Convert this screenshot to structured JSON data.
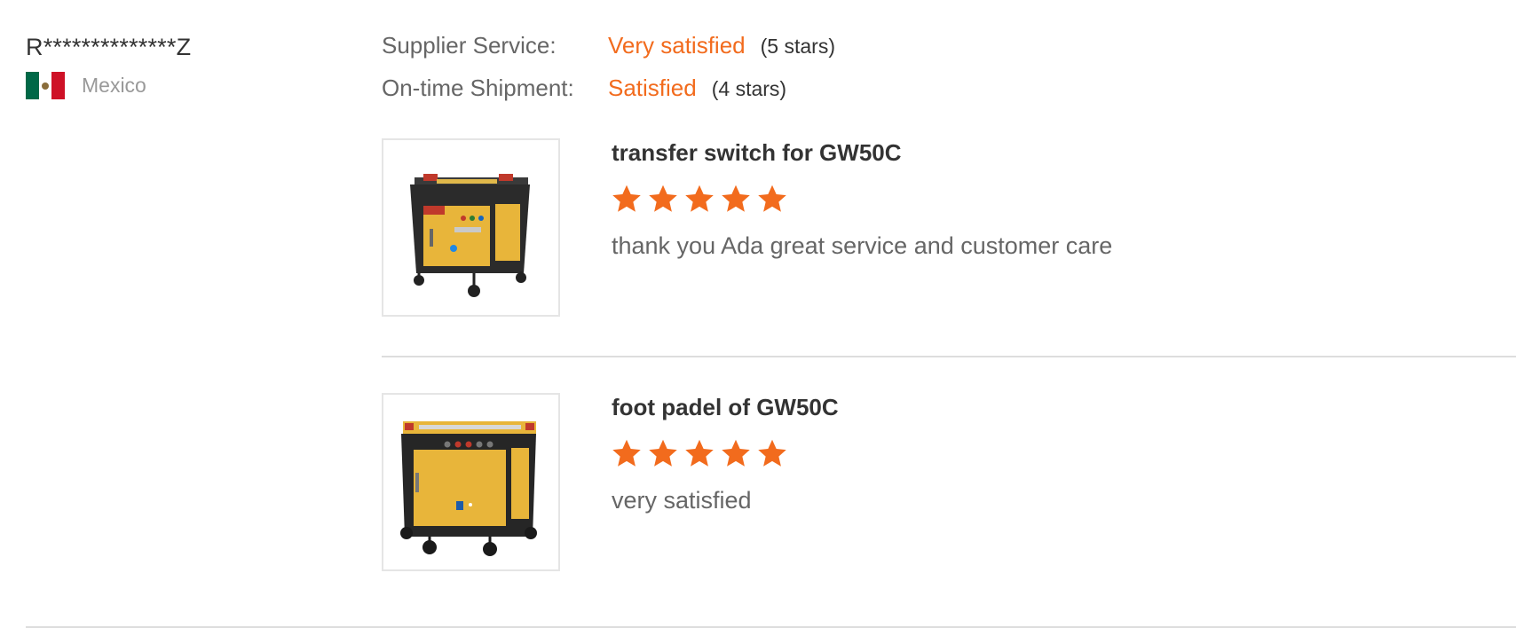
{
  "reviewer": {
    "name": "R**************Z",
    "country": "Mexico",
    "flag_colors": [
      "#006847",
      "#ffffff",
      "#ce1126"
    ]
  },
  "ratings": [
    {
      "label": "Supplier Service:",
      "value": "Very satisfied",
      "stars_text": "(5 stars)"
    },
    {
      "label": "On-time Shipment:",
      "value": "Satisfied",
      "stars_text": "(4 stars)"
    }
  ],
  "accent_color": "#f26b1d",
  "products": [
    {
      "title": "transfer switch for GW50C",
      "rating": 5,
      "review": "thank you Ada great service and customer care",
      "image_icon": "rebar-bender-machine-icon"
    },
    {
      "title": "foot padel of GW50C",
      "rating": 5,
      "review": "very satisfied",
      "image_icon": "rebar-bender-machine-icon"
    }
  ]
}
